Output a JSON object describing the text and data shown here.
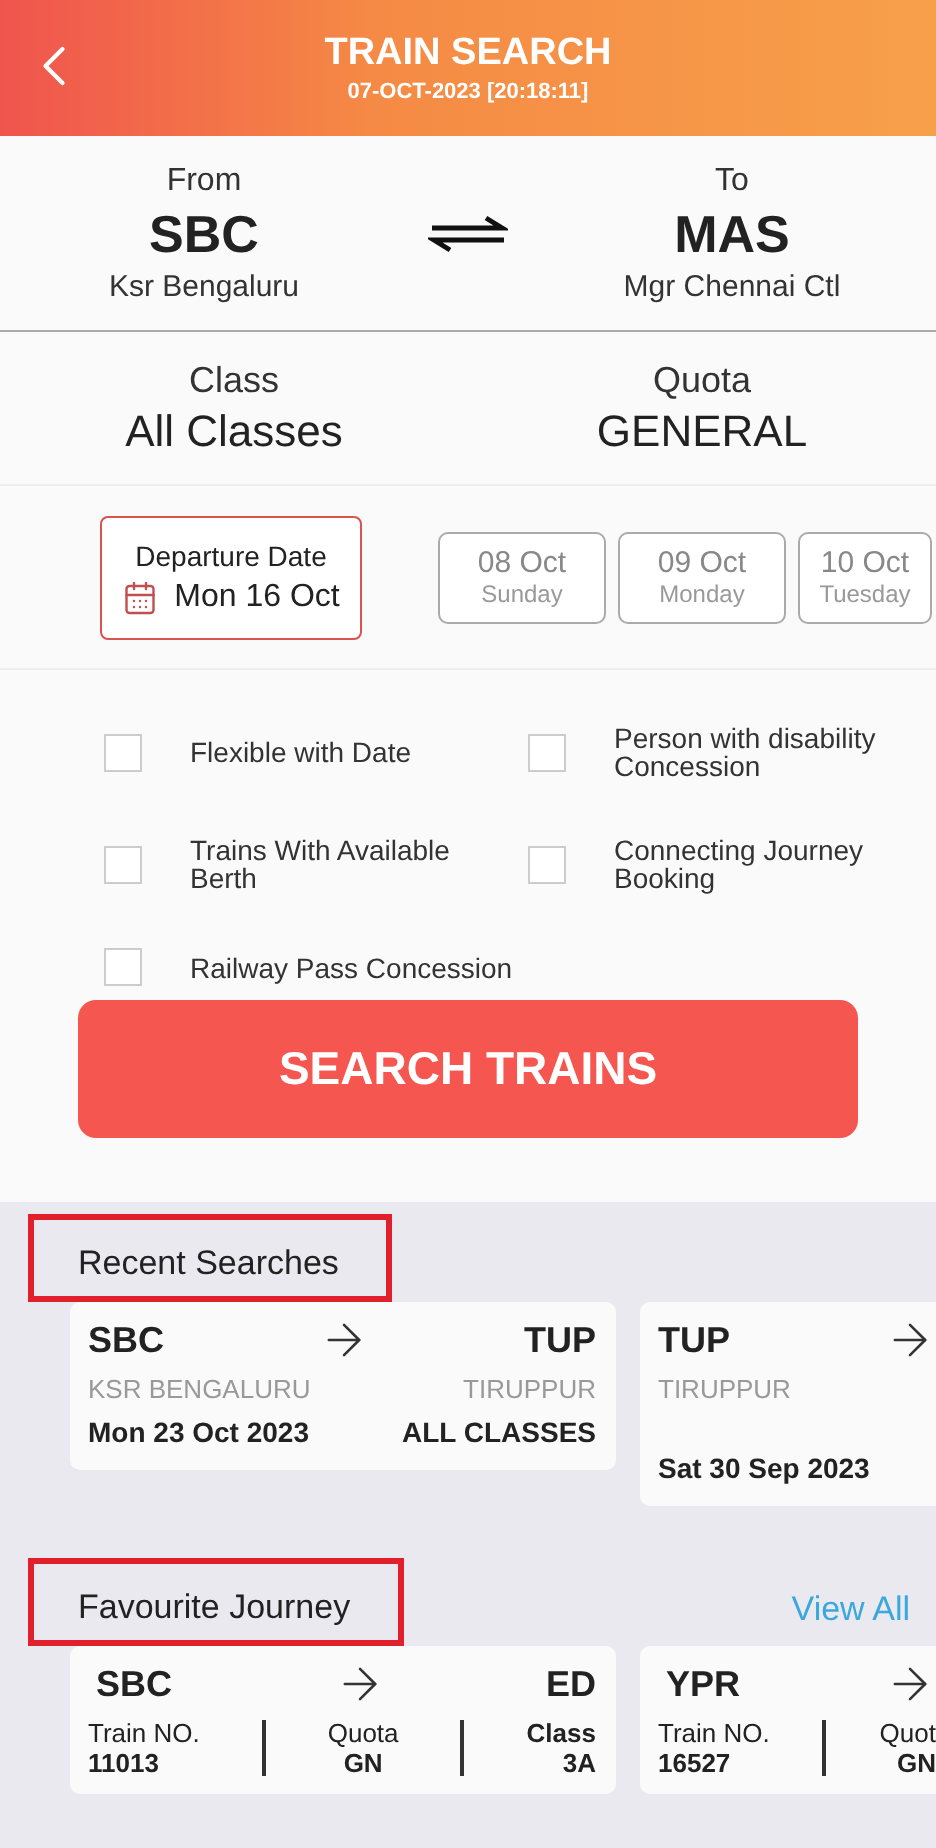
{
  "header": {
    "title": "TRAIN SEARCH",
    "subtitle": "07-OCT-2023 [20:18:11]"
  },
  "route": {
    "from": {
      "label": "From",
      "code": "SBC",
      "name": "Ksr Bengaluru"
    },
    "to": {
      "label": "To",
      "code": "MAS",
      "name": "Mgr Chennai Ctl"
    }
  },
  "class_quota": {
    "class": {
      "label": "Class",
      "value": "All Classes"
    },
    "quota": {
      "label": "Quota",
      "value": "GENERAL"
    }
  },
  "departure": {
    "label": "Departure Date",
    "date": "Mon 16 Oct"
  },
  "date_chips": [
    {
      "date": "08 Oct",
      "day": "Sunday"
    },
    {
      "date": "09 Oct",
      "day": "Monday"
    },
    {
      "date": "10 Oct",
      "day": "Tuesday"
    }
  ],
  "options": [
    {
      "label": "Flexible with Date",
      "checked": false
    },
    {
      "label": "Person with disability Concession",
      "checked": false
    },
    {
      "label": "Trains With Available Berth",
      "checked": false
    },
    {
      "label": "Connecting Journey Booking",
      "checked": false
    },
    {
      "label": "Railway Pass Concession",
      "checked": false
    }
  ],
  "search_button": "SEARCH TRAINS",
  "recent": {
    "title": "Recent Searches",
    "highlighted": true,
    "cards": [
      {
        "from_code": "SBC",
        "from_name": "KSR BENGALURU",
        "to_code": "TUP",
        "to_name": "TIRUPPUR",
        "date": "Mon 23 Oct 2023",
        "class": "ALL CLASSES"
      },
      {
        "from_code": "TUP",
        "from_name": "TIRUPPUR",
        "date": "Sat 30 Sep 2023"
      }
    ]
  },
  "favourites": {
    "title": "Favourite Journey",
    "highlighted": true,
    "view_all": "View All",
    "cards": [
      {
        "from_code": "SBC",
        "to_code": "ED",
        "train_label": "Train NO.",
        "train_no": "11013",
        "quota_label": "Quota",
        "quota": "GN",
        "class_label": "Class",
        "class": "3A"
      },
      {
        "from_code": "YPR",
        "train_label": "Train NO.",
        "train_no": "16527",
        "quota_label": "Quot",
        "quota": "GN"
      }
    ]
  }
}
